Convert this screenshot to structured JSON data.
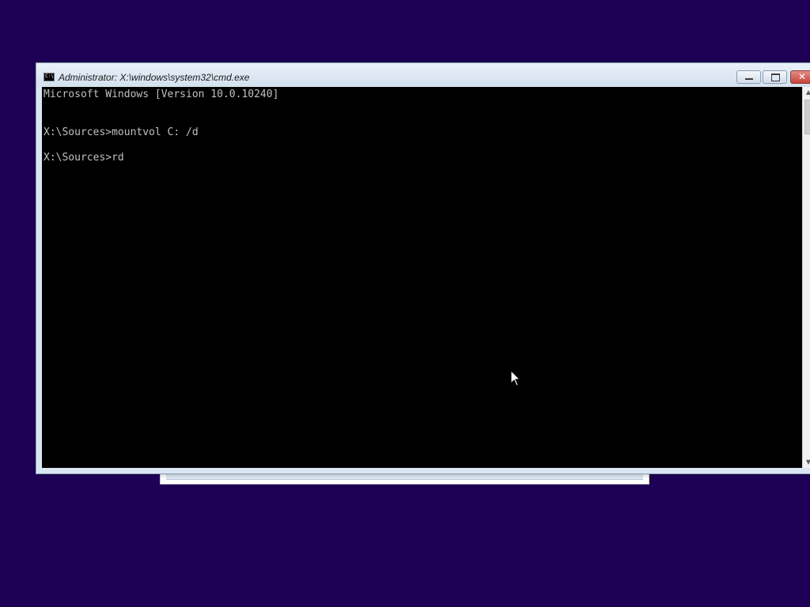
{
  "window": {
    "title": "Administrator: X:\\windows\\system32\\cmd.exe",
    "controls": {
      "minimize_label": "",
      "maximize_label": "",
      "close_label": "✕"
    }
  },
  "console": {
    "lines": [
      "Microsoft Windows [Version 10.0.10240]",
      "",
      "X:\\Sources>mountvol C: /d",
      "",
      "X:\\Sources>rd"
    ]
  },
  "scrollbar": {
    "up_icon": "▲",
    "down_icon": "▼"
  },
  "colors": {
    "desktop": "#1e0057",
    "console_bg": "#000000",
    "console_text": "#c0c0c0",
    "close_button": "#c8433a"
  }
}
